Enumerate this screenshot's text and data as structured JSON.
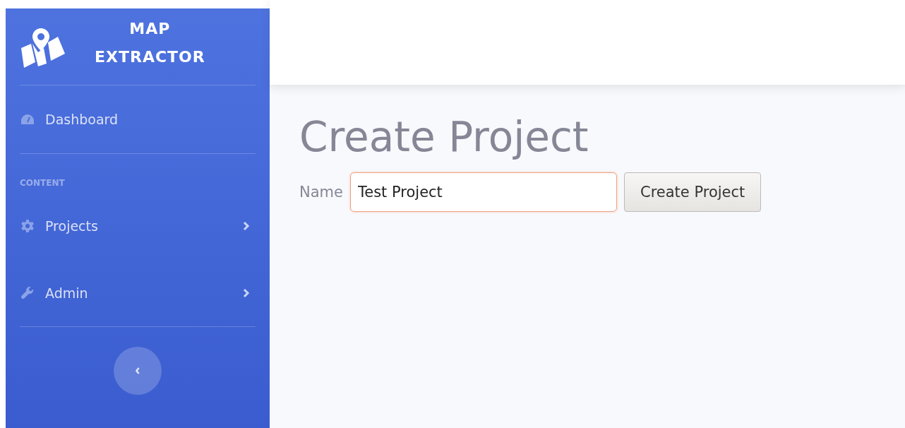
{
  "brand": {
    "line1": "MAP",
    "line2": "EXTRACTOR"
  },
  "sidebar": {
    "items": [
      {
        "kind": "link",
        "label": "Dashboard",
        "has_children": false
      },
      {
        "kind": "heading",
        "label": "CONTENT"
      },
      {
        "kind": "link",
        "label": "Projects",
        "has_children": true
      },
      {
        "kind": "link",
        "label": "Admin",
        "has_children": true
      }
    ]
  },
  "page": {
    "title": "Create Project"
  },
  "form": {
    "label": "Name",
    "value": "Test Project",
    "button": "Create Project"
  }
}
